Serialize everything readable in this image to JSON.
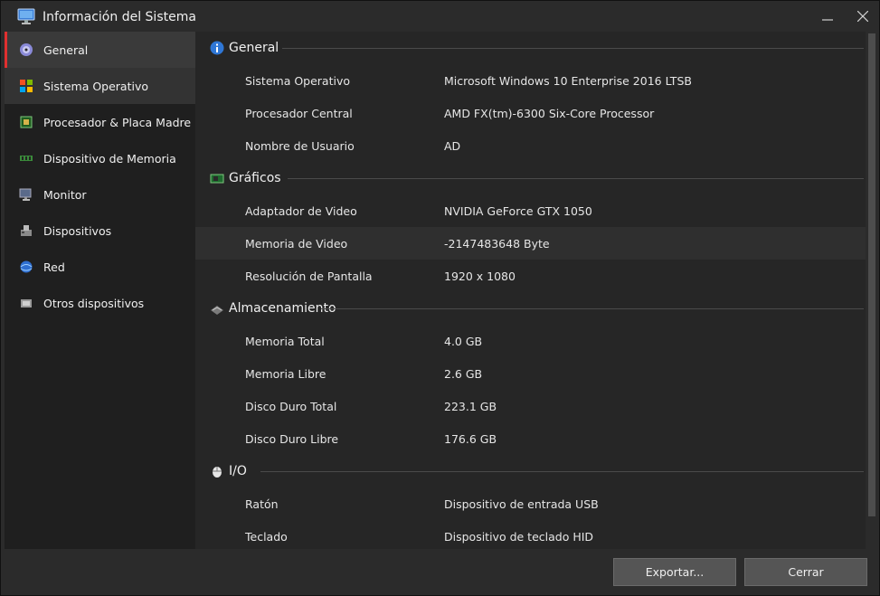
{
  "window": {
    "title": "Información del Sistema",
    "app_icon": "monitor-icon"
  },
  "sidebar": {
    "items": [
      {
        "label": "General",
        "icon": "disc-icon",
        "active": true
      },
      {
        "label": "Sistema Operativo",
        "icon": "windows-logo-icon"
      },
      {
        "label": "Procesador & Placa Madre",
        "icon": "cpu-icon"
      },
      {
        "label": "Dispositivo de Memoria",
        "icon": "ram-icon"
      },
      {
        "label": "Monitor",
        "icon": "monitor-icon"
      },
      {
        "label": "Dispositivos",
        "icon": "devices-icon"
      },
      {
        "label": "Red",
        "icon": "network-icon"
      },
      {
        "label": "Otros dispositivos",
        "icon": "other-devices-icon"
      }
    ]
  },
  "sections": [
    {
      "title": "General",
      "icon": "info-icon",
      "rows": [
        {
          "label": "Sistema Operativo",
          "value": "Microsoft Windows 10 Enterprise 2016 LTSB"
        },
        {
          "label": "Procesador Central",
          "value": "AMD FX(tm)-6300 Six-Core Processor"
        },
        {
          "label": "Nombre de Usuario",
          "value": "AD"
        }
      ]
    },
    {
      "title": "Gráficos",
      "icon": "graphics-card-icon",
      "rows": [
        {
          "label": "Adaptador de Video",
          "value": "NVIDIA GeForce GTX 1050"
        },
        {
          "label": "Memoria de Video",
          "value": "-2147483648 Byte"
        },
        {
          "label": "Resolución de Pantalla",
          "value": "1920 x 1080"
        }
      ]
    },
    {
      "title": "Almacenamiento",
      "icon": "storage-icon",
      "rows": [
        {
          "label": "Memoria Total",
          "value": "4.0 GB"
        },
        {
          "label": "Memoria Libre",
          "value": "2.6 GB"
        },
        {
          "label": "Disco Duro Total",
          "value": "223.1 GB"
        },
        {
          "label": "Disco Duro Libre",
          "value": "176.6 GB"
        }
      ]
    },
    {
      "title": "I/O",
      "icon": "mouse-icon",
      "rows": [
        {
          "label": "Ratón",
          "value": "Dispositivo de entrada USB"
        },
        {
          "label": "Teclado",
          "value": "Dispositivo de teclado HID"
        }
      ]
    }
  ],
  "footer": {
    "export_label": "Exportar...",
    "close_label": "Cerrar"
  },
  "colors": {
    "accent": "#e03030",
    "background": "#2b2b2b",
    "sidebar": "#1f1f1f",
    "content": "#262626"
  }
}
